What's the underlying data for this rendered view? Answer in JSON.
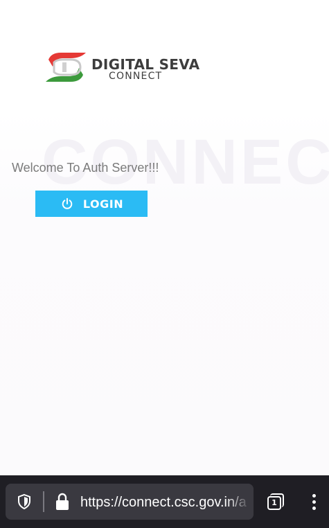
{
  "brand": {
    "title": "DIGITAL SEVA",
    "subtitle": "CONNECT",
    "logo_icon": "digital-seva-logo",
    "colors": {
      "red": "#e53935",
      "green": "#3c9a3c",
      "text": "#3d3d3d"
    }
  },
  "watermark": {
    "text": "CONNECT"
  },
  "main": {
    "welcome_text": "Welcome To Auth Server!!!",
    "login_button": {
      "label": "LOGIN",
      "icon": "power-icon",
      "color": "#2bbbf4"
    }
  },
  "browser": {
    "url": "https://connect.csc.gov.in/a",
    "shield_icon": "shield-icon",
    "lock_icon": "lock-icon",
    "tab_count": "1",
    "menu_icon": "more-vertical-icon"
  }
}
